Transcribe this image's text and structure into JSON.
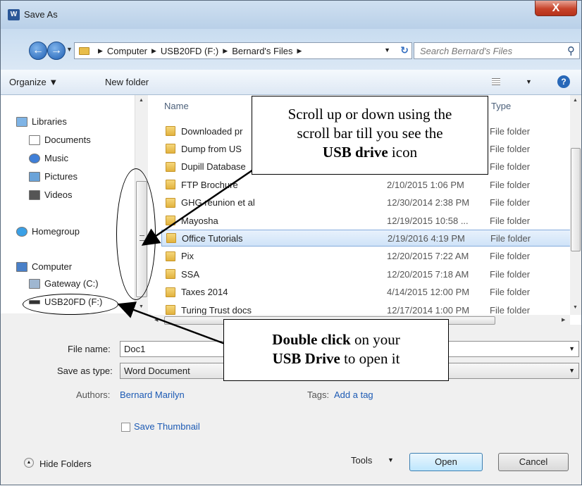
{
  "window": {
    "title": "Save As",
    "app_icon": "W",
    "close_label": "X"
  },
  "address": {
    "crumbs": [
      "Computer",
      "USB20FD (F:)",
      "Bernard's Files"
    ],
    "search_placeholder": "Search Bernard's Files"
  },
  "toolbar": {
    "organize": "Organize ▼",
    "new_folder": "New folder",
    "help": "?"
  },
  "nav": {
    "libraries": "Libraries",
    "documents": "Documents",
    "music": "Music",
    "pictures": "Pictures",
    "videos": "Videos",
    "homegroup": "Homegroup",
    "computer": "Computer",
    "gateway": "Gateway (C:)",
    "usb": "USB20FD (F:)"
  },
  "columns": {
    "name": "Name",
    "type": "Type"
  },
  "files": [
    {
      "name": "Downloaded pr",
      "date": "",
      "type": "File folder"
    },
    {
      "name": "Dump from US",
      "date": "",
      "type": "File folder"
    },
    {
      "name": "Dupill Database",
      "date": "",
      "type": "File folder"
    },
    {
      "name": "FTP Brochure",
      "date": "2/10/2015 1:06 PM",
      "type": "File folder"
    },
    {
      "name": "GHG reunion et al",
      "date": "12/30/2014 2:38 PM",
      "type": "File folder"
    },
    {
      "name": "Mayosha",
      "date": "12/19/2015 10:58 ...",
      "type": "File folder"
    },
    {
      "name": "Office Tutorials",
      "date": "2/19/2016 4:19 PM",
      "type": "File folder",
      "selected": true
    },
    {
      "name": "Pix",
      "date": "12/20/2015 7:22 AM",
      "type": "File folder"
    },
    {
      "name": "SSA",
      "date": "12/20/2015 7:18 AM",
      "type": "File folder"
    },
    {
      "name": "Taxes 2014",
      "date": "4/14/2015 12:00 PM",
      "type": "File folder"
    },
    {
      "name": "Turing Trust docs",
      "date": "12/17/2014 1:00 PM",
      "type": "File folder"
    }
  ],
  "form": {
    "file_name_label": "File name:",
    "file_name_value": "Doc1",
    "save_type_label": "Save as type:",
    "save_type_value": "Word Document",
    "authors_label": "Authors:",
    "authors_value": "Bernard Marilyn",
    "tags_label": "Tags:",
    "tags_value": "Add a tag",
    "thumbnail_label": "Save Thumbnail"
  },
  "footer": {
    "hide_folders": "Hide Folders",
    "tools": "Tools",
    "open": "Open",
    "cancel": "Cancel"
  },
  "callouts": {
    "scroll_line1": "Scroll up or down using the",
    "scroll_line2": "scroll bar till you see the",
    "scroll_bold": "USB drive",
    "scroll_tail": " icon",
    "dbl_bold": "Double click",
    "dbl_tail": " on your",
    "usb_bold": "USB Drive",
    "usb_tail": " to open it"
  }
}
